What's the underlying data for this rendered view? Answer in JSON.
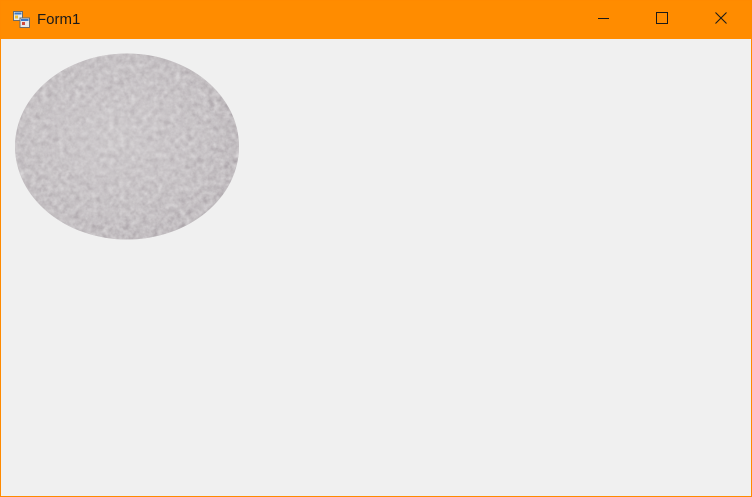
{
  "window": {
    "title": "Form1",
    "accent_color": "#ff8c00",
    "icons": {
      "app": "form-app-icon",
      "minimize": "minimize-icon",
      "maximize": "maximize-icon",
      "close": "close-icon"
    }
  },
  "client": {
    "background_color": "#f0f0f0",
    "picture": {
      "shape": "ellipse",
      "texture": "gray-stone-texture",
      "fill_color": "#b9b3b7"
    }
  }
}
